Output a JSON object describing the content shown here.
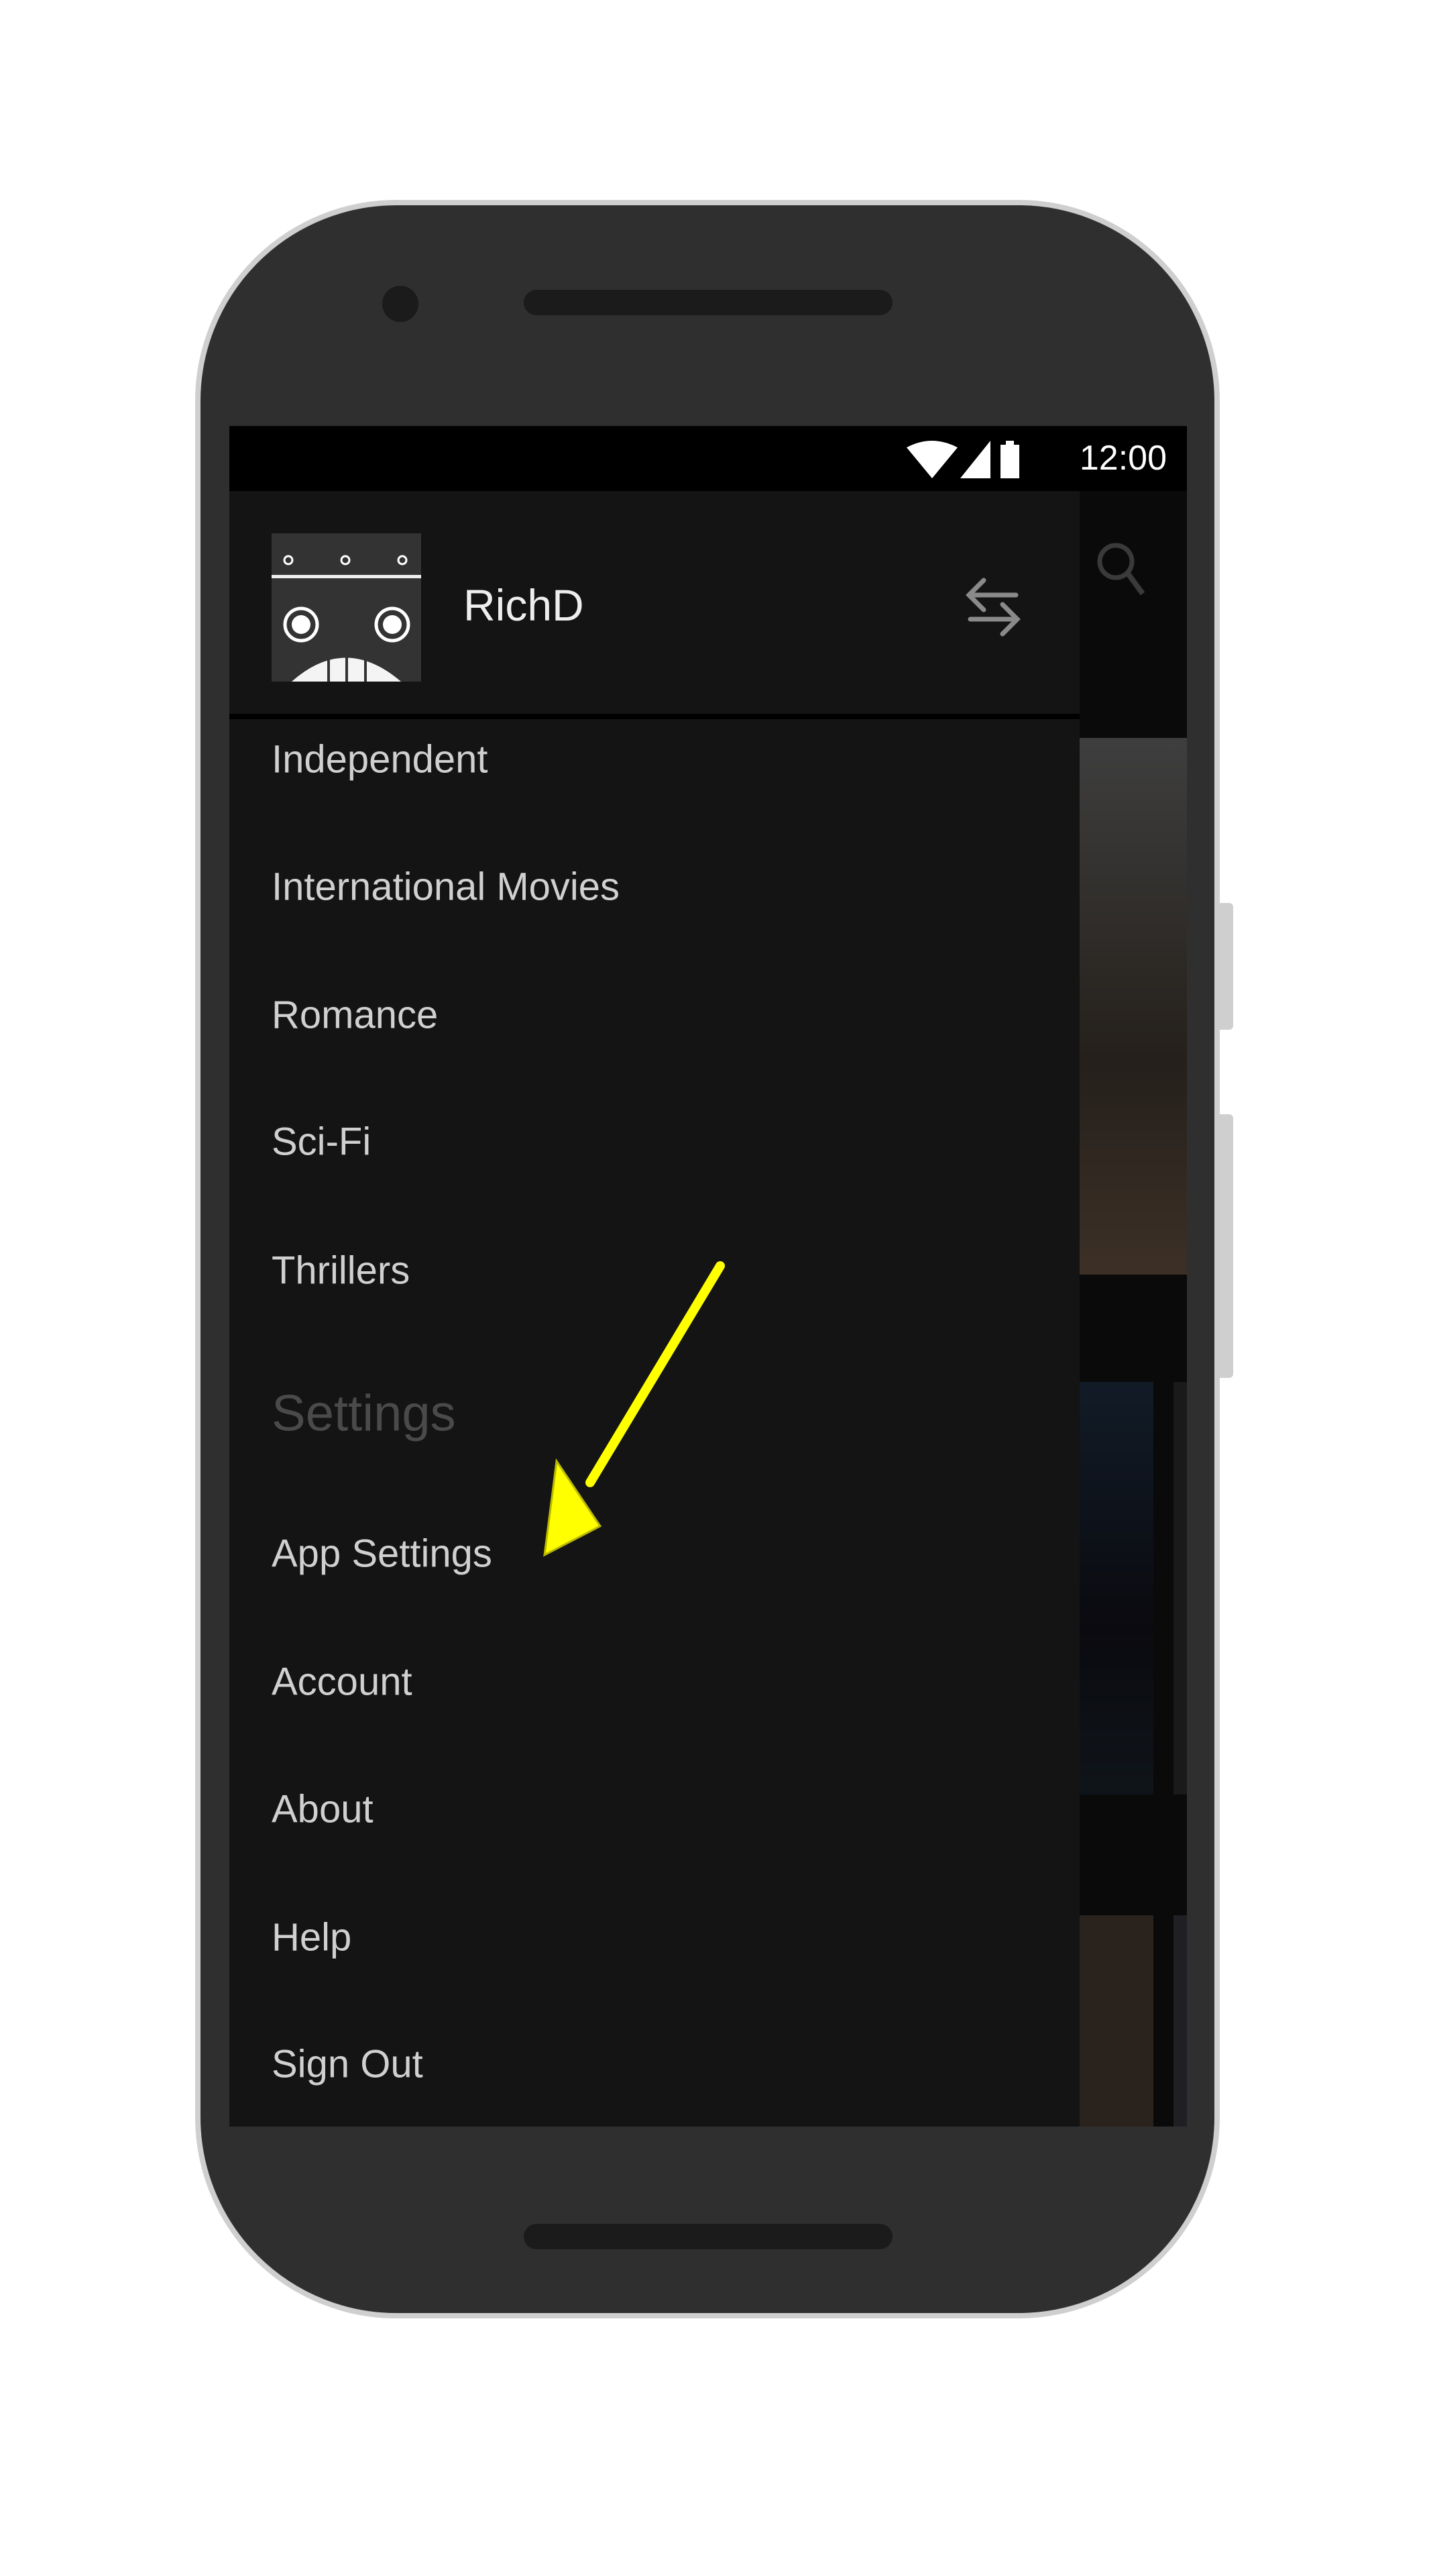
{
  "status_bar": {
    "time": "12:00",
    "icons": [
      "wifi-icon",
      "signal-icon",
      "battery-icon"
    ]
  },
  "drawer": {
    "username": "RichD",
    "switch_profile_icon": "swap-arrows-icon",
    "items": [
      {
        "label": "Independent"
      },
      {
        "label": "International Movies"
      },
      {
        "label": "Romance"
      },
      {
        "label": "Sci-Fi"
      },
      {
        "label": "Thrillers"
      }
    ],
    "settings_section": "Settings",
    "settings_items": [
      {
        "label": "App Settings"
      },
      {
        "label": "Account"
      },
      {
        "label": "About"
      },
      {
        "label": "Help"
      },
      {
        "label": "Sign Out"
      }
    ]
  },
  "annotation": {
    "color": "#ffff00",
    "target": "App Settings"
  }
}
